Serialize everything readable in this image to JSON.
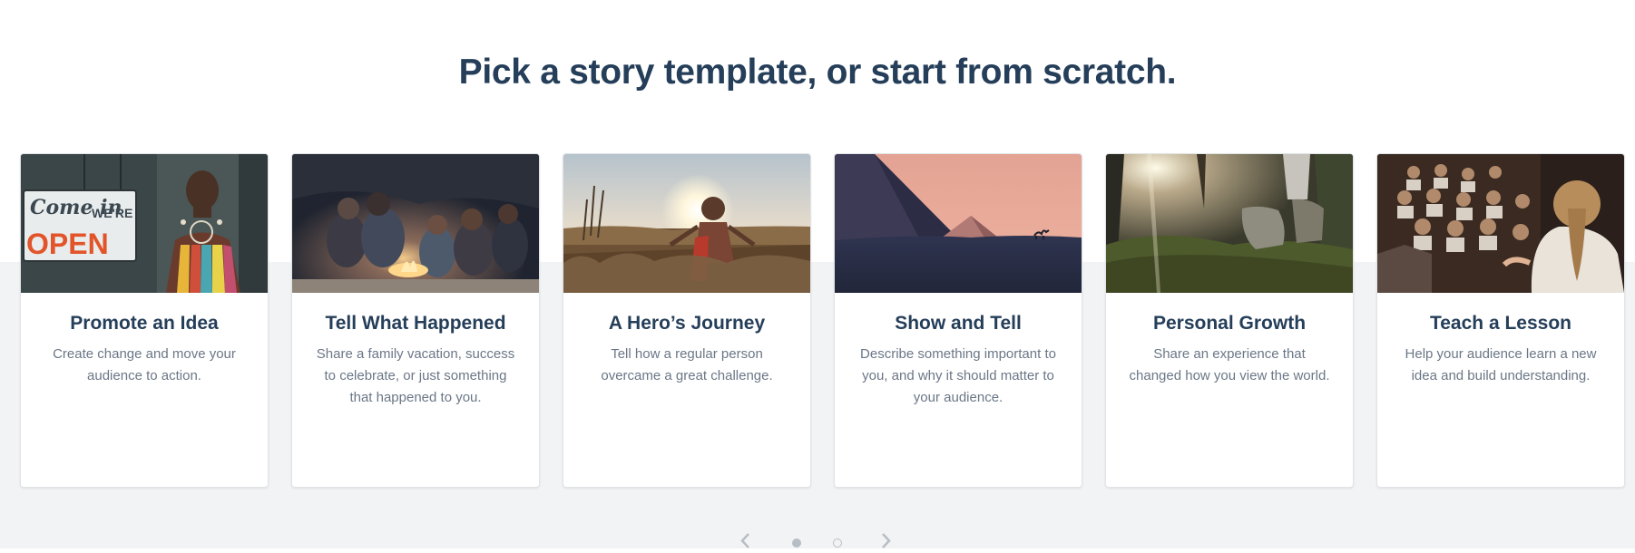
{
  "page": {
    "heading": "Pick a story template, or start from scratch."
  },
  "templates": [
    {
      "title": "Promote an Idea",
      "description": "Create change and move your audience to action.",
      "image": "storefront-open-sign-woman-photo"
    },
    {
      "title": "Tell What Happened",
      "description": "Share a family vacation, success to celebrate, or just something that happened to you.",
      "image": "campfire-group-photo"
    },
    {
      "title": "A Hero’s Journey",
      "description": "Tell how a regular person overcame a great challenge.",
      "image": "child-in-wheat-field-photo"
    },
    {
      "title": "Show and Tell",
      "description": "Describe something important to you, and why it should matter to your audience.",
      "image": "pyramids-camel-sunset-photo"
    },
    {
      "title": "Personal Growth",
      "description": "Share an experience that changed how you view the world.",
      "image": "hiker-boots-trail-photo"
    },
    {
      "title": "Teach a Lesson",
      "description": "Help your audience learn a new idea and build understanding.",
      "image": "presenter-audience-theater-photo"
    }
  ],
  "sign": {
    "line1": "Come in",
    "line2": "WE'RE",
    "line3": "OPEN"
  },
  "pager": {
    "page_count": 2,
    "current_page": 1,
    "prev_icon": "chevron-left-icon",
    "next_icon": "chevron-right-icon"
  },
  "colors": {
    "heading": "#253e59",
    "body_text": "#6b7787",
    "band": "#f2f3f5",
    "card_border": "#e1e4e8",
    "pager": "#b8bec6"
  }
}
